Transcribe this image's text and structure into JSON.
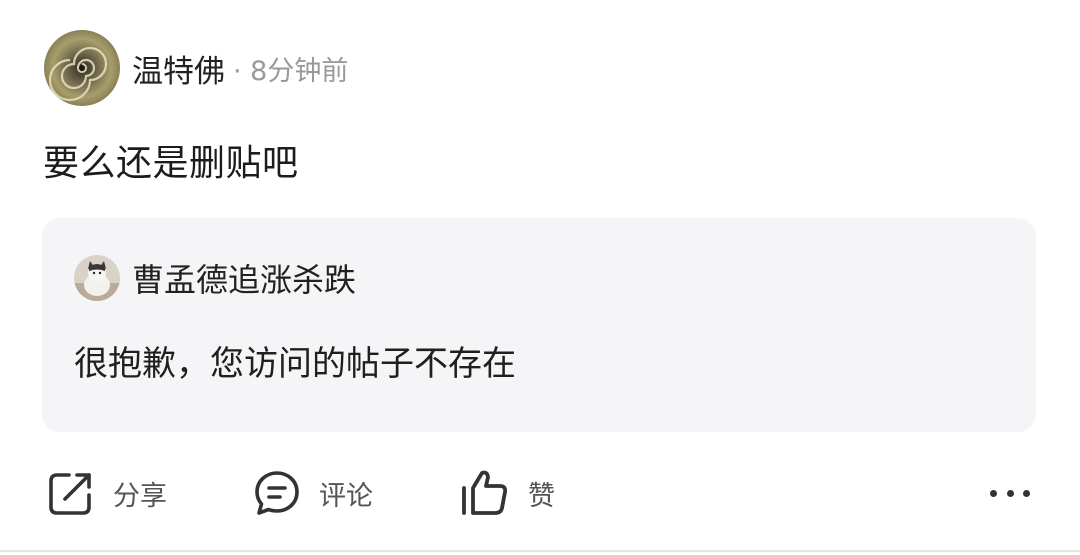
{
  "post": {
    "author": {
      "name": "温特佛",
      "avatar_icon": "shell-avatar"
    },
    "meta": "· 8分钟前",
    "text": "要么还是删贴吧",
    "quoted": {
      "author_name": "曹孟德追涨杀跌",
      "avatar_icon": "cat-avatar",
      "text": "很抱歉，您访问的帖子不存在"
    }
  },
  "actions": {
    "share": {
      "label": "分享",
      "icon": "share-icon"
    },
    "comment": {
      "label": "评论",
      "icon": "comment-icon"
    },
    "like": {
      "label": "赞",
      "icon": "thumbs-up-icon"
    },
    "more_icon": "more-dots-icon"
  },
  "colors": {
    "background": "#ffffff",
    "quote_bg": "#f5f5f7",
    "meta_text": "#9a9a9a",
    "icon": "#333333",
    "divider": "#e6e6e6"
  }
}
